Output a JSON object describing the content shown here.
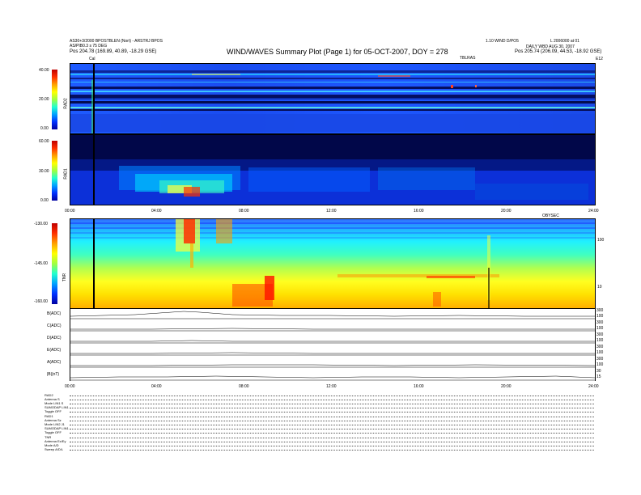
{
  "header": {
    "title": "WIND/WAVES Summary Plot (Page 1) for 05-OCT-2007, DOY = 278",
    "left_line1": "AS30+3/2000 BPOSTBLEN (Nort) - ARSTRJ BPOS",
    "left_line2": "AS/PIB0.3 s 75 DEG",
    "left_pos": "Pos  204.78 (169.89, 40.89, -18.29 GSE)",
    "right_line1": "1.10 WIND D/PO5",
    "right_line2": "L 2006000 at 01",
    "right_line3": "DAILY WBD AUG 30, 2007",
    "right_pos": "Pos  205.74 (206.09, 44.53, -18.92 GSE)",
    "right_label": "TBLRAS",
    "cal_marker": "Cal",
    "corner_right": "E12"
  },
  "colors": {
    "spectro_bg": "#0a2bd6",
    "panel_border": "#000000"
  },
  "chart_data": [
    {
      "type": "heatmap",
      "panel": "RAD2",
      "ylabel": "RAD2",
      "yticks": [
        "40.00",
        "20.00",
        "0.00"
      ],
      "ylim": [
        0,
        40
      ]
    },
    {
      "type": "heatmap",
      "panel": "RAD1",
      "ylabel": "RAD1",
      "yticks": [
        "60.00",
        "30.00",
        "0.00"
      ],
      "ylim": [
        0,
        60
      ],
      "xticks": [
        "00:00",
        "04:00",
        "08:00",
        "12:00",
        "16:00",
        "20:00",
        "24:00"
      ],
      "x_right_label": "OBYSEC"
    },
    {
      "type": "heatmap",
      "panel": "TNR",
      "ylabel": "TNR",
      "yticks": [
        "-130.00",
        "-145.00",
        "-160.00"
      ],
      "ylim": [
        -160,
        -130
      ],
      "right_ticks": [
        "100",
        "10"
      ]
    },
    {
      "type": "line",
      "panel": "stack",
      "rows": [
        {
          "label": "B(ADC)",
          "right": [
            "300",
            "100"
          ]
        },
        {
          "label": "C(ADC)",
          "right": [
            "300",
            "100"
          ]
        },
        {
          "label": "D(ADC)",
          "right": [
            "300",
            "100"
          ]
        },
        {
          "label": "E(ADC)",
          "right": [
            "300",
            "100"
          ]
        },
        {
          "label": "A(ADC)",
          "right": [
            "300",
            "100"
          ]
        },
        {
          "label": "|B|(nT)",
          "right": [
            "30",
            "15"
          ]
        }
      ],
      "xticks": [
        "00:00",
        "04:00",
        "08:00",
        "12:00",
        "16:00",
        "20:00",
        "24:00"
      ]
    }
  ],
  "params": {
    "lines": [
      "RAD2",
      "Antenna       S",
      "Mode     LIN1 S",
      "SUMODAP  LIN1",
      "Toggle    OFF",
      "RAD1",
      "Antenna       Sz",
      "Mode     LIN2 J1",
      "SUMODAP  LIN1",
      "Toggle    OFF",
      "TNR",
      "Antenna   Ex/Ey",
      "Mode       A/D",
      "Sweep      A/D/L"
    ]
  }
}
